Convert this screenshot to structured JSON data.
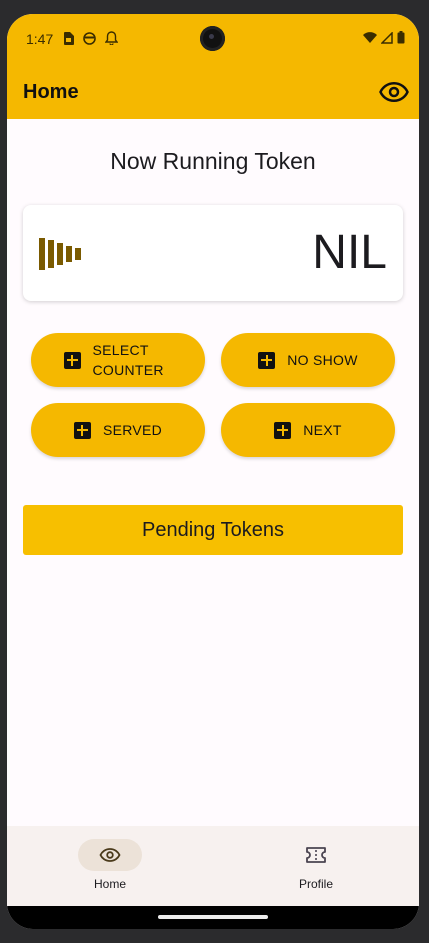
{
  "status_bar": {
    "time": "1:47",
    "icons_left": [
      "sim-card-icon",
      "face-icon",
      "bell-icon"
    ],
    "icons_right": [
      "wifi-icon",
      "signal-icon",
      "battery-icon"
    ]
  },
  "app_bar": {
    "title": "Home",
    "action_icon": "eye-icon"
  },
  "main": {
    "heading": "Now Running Token",
    "token_icon": "equalizer-icon",
    "token_value": "NIL",
    "actions": [
      {
        "label": "SELECT COUNTER",
        "icon": "add-box-icon"
      },
      {
        "label": "NO SHOW",
        "icon": "add-box-icon"
      },
      {
        "label": "SERVED",
        "icon": "add-box-icon"
      },
      {
        "label": "NEXT",
        "icon": "add-box-icon"
      }
    ],
    "pending_label": "Pending Tokens"
  },
  "bottom_nav": {
    "items": [
      {
        "label": "Home",
        "icon": "eye-icon",
        "selected": true
      },
      {
        "label": "Profile",
        "icon": "ticket-icon",
        "selected": false
      }
    ]
  },
  "colors": {
    "accent": "#f5b800",
    "background": "#fffbfe",
    "nav_background": "#f7f1ef",
    "nav_pill": "#ece2d8",
    "token_icon": "#7a5a00"
  }
}
